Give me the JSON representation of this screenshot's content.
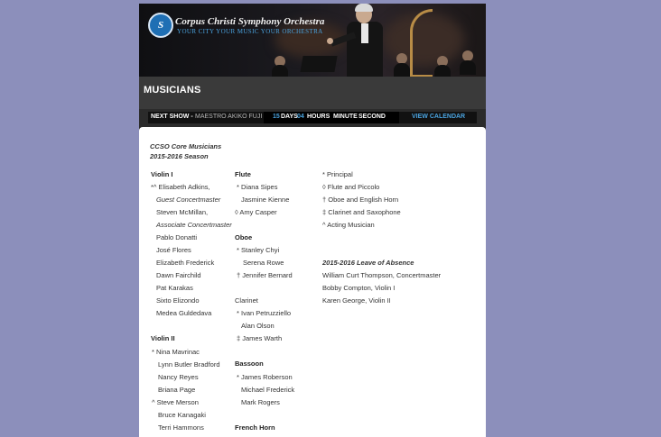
{
  "header": {
    "org_name": "Corpus Christi Symphony Orchestra",
    "tagline": "YOUR CITY  YOUR MUSIC  YOUR ORCHESTRA",
    "logo_text": "CCSO"
  },
  "page": {
    "title": "MUSICIANS"
  },
  "show_bar": {
    "next_show_label": "NEXT SHOW -",
    "next_show_name": "MAESTRO AKIKO FUJI",
    "days_value": "15",
    "days_label": "DAYS",
    "hours_value": "04",
    "hours_label": "HOURS",
    "minute_label": "MINUTE",
    "second_label": "SECOND",
    "calendar_link": "VIEW CALENDAR"
  },
  "content": {
    "intro_line1": "CCSO Core Musicians",
    "intro_line2": "2015-2016 Season",
    "col1": {
      "violin1_heading": "Violin I",
      "violin1": [
        "*^ Elisabeth Adkins,",
        "Guest Concertmaster",
        "Steven McMillan,",
        "Associate Concertmaster",
        "Pablo Donatti",
        "José Flores",
        "Elizabeth Frederick",
        "Dawn Fairchild",
        "Pat Karakas",
        "Sixto Elizondo",
        "Medea Guldedava"
      ],
      "violin2_heading": "Violin II",
      "violin2": [
        "* Nina Mavrinac",
        "Lynn Butler Bradford",
        "Nancy Reyes",
        "Briana Page",
        "^ Steve Merson",
        "Bruce Kanagaki",
        "Terri Hammons"
      ]
    },
    "col2": {
      "flute_heading": "Flute",
      "flute": [
        "* Diana Sipes",
        "Jasmine Kienne",
        "◊ Amy Casper"
      ],
      "oboe_heading": "Oboe",
      "oboe": [
        "* Stanley Chyi",
        "Serena Rowe",
        "† Jennifer Bernard"
      ],
      "clarinet_heading": "Clarinet",
      "clarinet": [
        "* Ivan Petruzziello",
        "Alan Olson",
        "‡ James Warth"
      ],
      "bassoon_heading": "Bassoon",
      "bassoon": [
        "* James Roberson",
        "Michael Frederick",
        "Mark Rogers"
      ],
      "horn_heading": "French Horn"
    },
    "col3": {
      "legend": [
        "* Principal",
        "◊ Flute and Piccolo",
        "† Oboe and English Horn",
        "‡ Clarinet and Saxophone",
        "^ Acting Musician"
      ],
      "leave_heading": "2015-2016 Leave of Absence",
      "leave": [
        "William Curt Thompson, Concertmaster",
        "Bobby  Compton, Violin I",
        "Karen George, Violin II"
      ]
    }
  }
}
